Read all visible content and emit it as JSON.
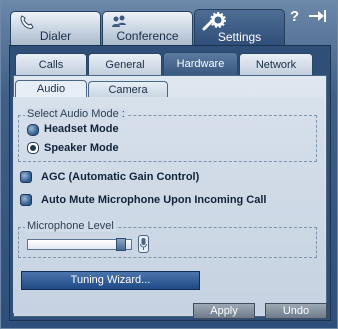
{
  "tabs": {
    "dialer": "Dialer",
    "conference": "Conference",
    "settings": "Settings"
  },
  "topbar": {
    "help": "?",
    "pin": "-→"
  },
  "subtabs": {
    "calls": "Calls",
    "general": "General",
    "hardware": "Hardware",
    "network": "Network"
  },
  "hardware_tabs": {
    "audio": "Audio",
    "camera": "Camera"
  },
  "audio_mode": {
    "title": "Select Audio Mode :",
    "headset": "Headset Mode",
    "speaker": "Speaker Mode",
    "selected": "Speaker Mode"
  },
  "options": {
    "agc": "AGC (Automatic Gain Control)",
    "auto_mute": "Auto Mute Microphone Upon Incoming Call"
  },
  "microphone": {
    "title": "Microphone Level",
    "level_fraction": 0.9
  },
  "buttons": {
    "tuning_wizard": "Tuning Wizard...",
    "apply": "Apply",
    "undo": "Undo"
  }
}
